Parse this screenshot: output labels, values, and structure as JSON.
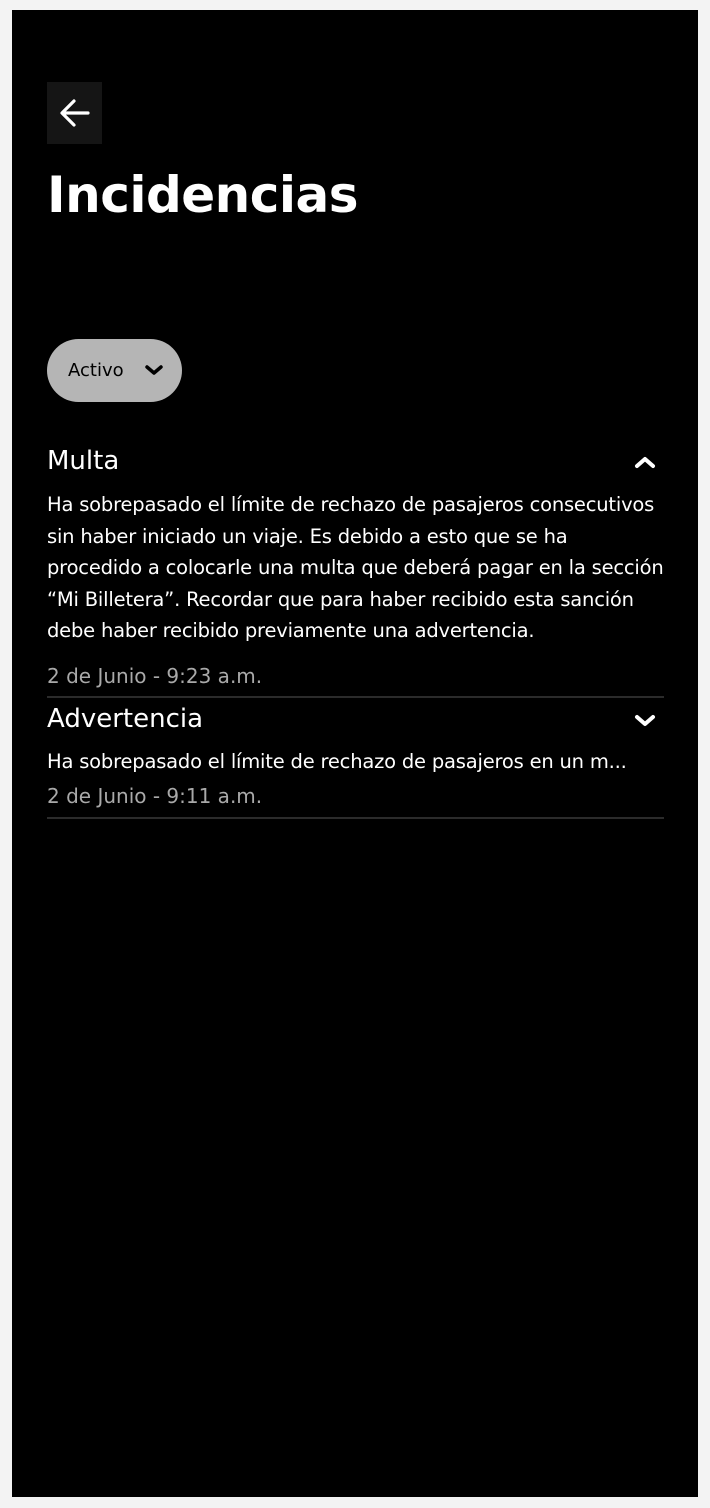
{
  "header": {
    "title": "Incidencias",
    "back_icon": "arrow-left-icon"
  },
  "filter": {
    "selected": "Activo",
    "icon": "chevron-down-icon"
  },
  "incidents": [
    {
      "title": "Multa",
      "expanded": true,
      "toggle_icon": "chevron-up-icon",
      "body": "Ha sobrepasado el límite de rechazo de pasajeros consecutivos sin haber iniciado un viaje. Es debido a esto que se ha procedido a colocarle una multa que deberá pagar en la sección “Mi Billetera”. Recordar que para haber recibido esta sanción debe haber recibido previamente una advertencia.",
      "date": "2 de Junio - 9:23 a.m."
    },
    {
      "title": "Advertencia",
      "expanded": false,
      "toggle_icon": "chevron-down-icon",
      "body": "Ha sobrepasado el límite de rechazo de pasajeros en un m...",
      "date": "2 de Junio - 9:11 a.m."
    }
  ],
  "colors": {
    "background": "#000000",
    "text": "#ffffff",
    "muted": "#a9a9a9",
    "pill": "#b5b5b5",
    "divider": "#2b2b2b"
  }
}
